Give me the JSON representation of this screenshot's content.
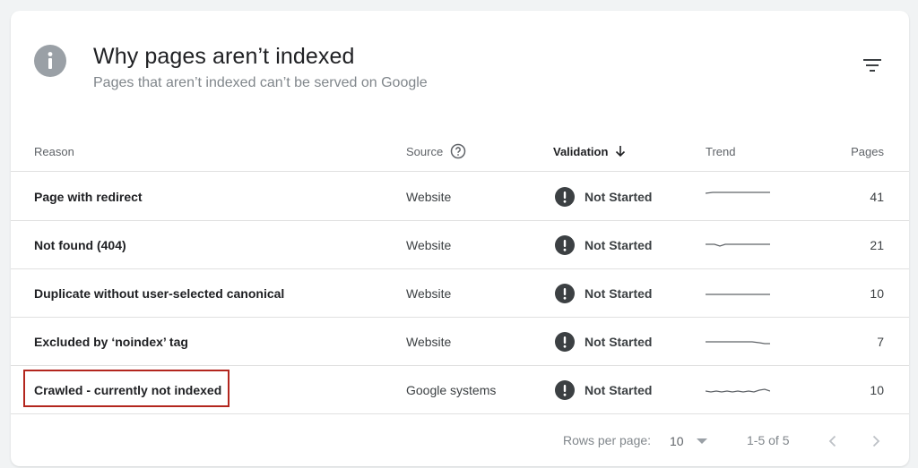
{
  "header": {
    "title": "Why pages aren’t indexed",
    "subtitle": "Pages that aren’t indexed can’t be served on Google"
  },
  "table": {
    "columns": {
      "reason": "Reason",
      "source": "Source",
      "validation": "Validation",
      "trend": "Trend",
      "pages": "Pages"
    },
    "rows": [
      {
        "reason": "Page with redirect",
        "source": "Website",
        "validation": "Not Started",
        "pages": "41"
      },
      {
        "reason": "Not found (404)",
        "source": "Website",
        "validation": "Not Started",
        "pages": "21"
      },
      {
        "reason": "Duplicate without user-selected canonical",
        "source": "Website",
        "validation": "Not Started",
        "pages": "10"
      },
      {
        "reason": "Excluded by ‘noindex’ tag",
        "source": "Website",
        "validation": "Not Started",
        "pages": "7"
      },
      {
        "reason": "Crawled - currently not indexed",
        "source": "Google systems",
        "validation": "Not Started",
        "pages": "10"
      }
    ],
    "highlighted_row": 4
  },
  "footer": {
    "rows_per_page_label": "Rows per page:",
    "rows_per_page_value": "10",
    "range": "1-5 of 5"
  },
  "icons": {
    "info": "info-icon",
    "filter": "filter-icon",
    "help": "help-circle-icon",
    "sort": "arrow-down-icon",
    "status": "alert-circle-icon",
    "prev": "chevron-left-icon",
    "next": "chevron-right-icon"
  },
  "colors": {
    "highlight": "#b3261e",
    "status_icon": "#3c4043",
    "info_icon": "#9aa0a6"
  }
}
